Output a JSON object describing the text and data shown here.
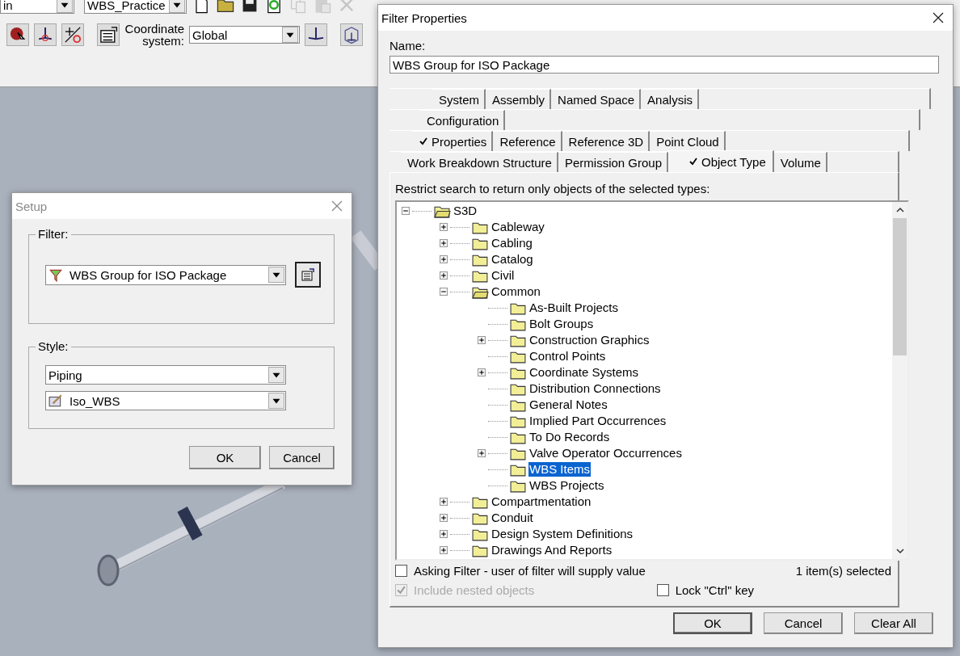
{
  "app": {
    "workspace_combo": "in",
    "filter_combo": "WBS_Practice",
    "coordinate_label": "Coordinate system:",
    "coordinate_value": "Global"
  },
  "setup": {
    "title": "Setup",
    "filter_label": "Filter:",
    "filter_value": "WBS Group for ISO Package",
    "style_label": "Style:",
    "style_values": [
      "Piping",
      "Iso_WBS"
    ],
    "buttons": [
      "OK",
      "Cancel"
    ]
  },
  "filter_properties": {
    "title": "Filter Properties",
    "name_label": "Name:",
    "name_value": "WBS Group for ISO Package",
    "tab_rows": [
      [
        {
          "label": "System",
          "checked": false,
          "selected": false
        },
        {
          "label": "Assembly",
          "checked": false,
          "selected": false
        },
        {
          "label": "Named Space",
          "checked": false,
          "selected": false
        },
        {
          "label": "Analysis",
          "checked": false,
          "selected": false
        }
      ],
      [
        {
          "label": "Configuration",
          "checked": false,
          "selected": false
        }
      ],
      [
        {
          "label": "Properties",
          "checked": true,
          "selected": false
        },
        {
          "label": "Reference",
          "checked": false,
          "selected": false
        },
        {
          "label": "Reference 3D",
          "checked": false,
          "selected": false
        },
        {
          "label": "Point Cloud",
          "checked": false,
          "selected": false
        }
      ],
      [
        {
          "label": "Work Breakdown Structure",
          "checked": false,
          "selected": false
        },
        {
          "label": "Permission Group",
          "checked": false,
          "selected": false
        },
        {
          "label": "Object Type",
          "checked": true,
          "selected": true
        },
        {
          "label": "Volume",
          "checked": false,
          "selected": false
        }
      ]
    ],
    "instruction": "Restrict search to return only objects of the selected types:",
    "tree": {
      "label": "S3D",
      "expanded": true,
      "selected": false,
      "children": [
        {
          "label": "Cableway",
          "expanded": false,
          "selected": false
        },
        {
          "label": "Cabling",
          "expanded": false,
          "selected": false
        },
        {
          "label": "Catalog",
          "expanded": false,
          "selected": false
        },
        {
          "label": "Civil",
          "expanded": false,
          "selected": false
        },
        {
          "label": "Common",
          "expanded": true,
          "selected": false,
          "children": [
            {
              "label": "As-Built Projects",
              "selected": false
            },
            {
              "label": "Bolt Groups",
              "selected": false
            },
            {
              "label": "Construction Graphics",
              "expanded": false,
              "selected": false
            },
            {
              "label": "Control Points",
              "selected": false
            },
            {
              "label": "Coordinate Systems",
              "expanded": false,
              "selected": false
            },
            {
              "label": "Distribution Connections",
              "selected": false
            },
            {
              "label": "General Notes",
              "selected": false
            },
            {
              "label": "Implied Part Occurrences",
              "selected": false
            },
            {
              "label": "To Do Records",
              "selected": false
            },
            {
              "label": "Valve Operator Occurrences",
              "expanded": false,
              "selected": false
            },
            {
              "label": "WBS Items",
              "selected": true
            },
            {
              "label": "WBS Projects",
              "selected": false
            }
          ]
        },
        {
          "label": "Compartmentation",
          "expanded": false,
          "selected": false
        },
        {
          "label": "Conduit",
          "expanded": false,
          "selected": false
        },
        {
          "label": "Design System Definitions",
          "expanded": false,
          "selected": false
        },
        {
          "label": "Drawings And Reports",
          "expanded": false,
          "selected": false
        }
      ]
    },
    "asking_filter": {
      "label": "Asking Filter - user of filter will supply value",
      "checked": false
    },
    "selection_count": "1 item(s) selected",
    "include_nested": {
      "label": "Include nested objects",
      "checked": true,
      "disabled": true
    },
    "lock_ctrl": {
      "label": "Lock \"Ctrl\" key",
      "checked": false
    },
    "buttons": [
      "OK",
      "Cancel",
      "Clear All"
    ]
  }
}
